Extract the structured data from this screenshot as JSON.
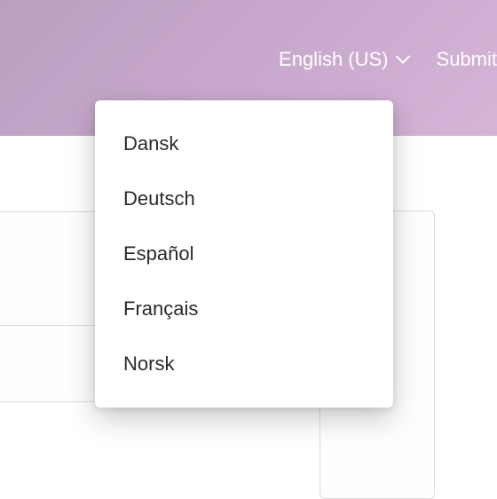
{
  "header": {
    "language_selector": {
      "current": "English (US)"
    },
    "submit_label": "Submit"
  },
  "language_dropdown": {
    "items": [
      {
        "label": "Dansk"
      },
      {
        "label": "Deutsch"
      },
      {
        "label": "Español"
      },
      {
        "label": "Français"
      },
      {
        "label": "Norsk"
      }
    ]
  }
}
